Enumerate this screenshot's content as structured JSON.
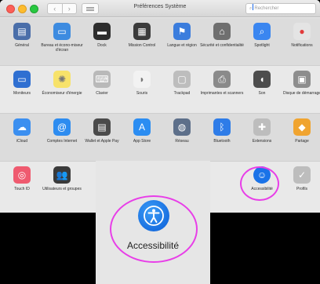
{
  "window": {
    "title": "Préférences Système"
  },
  "toolbar": {
    "back": "‹",
    "forward": "›",
    "search_placeholder": "Rechercher"
  },
  "rows": [
    {
      "items": [
        {
          "name": "general",
          "label": "Général",
          "icon": "general-icon",
          "color": "#4a6ea9",
          "glyph": "▤"
        },
        {
          "name": "desktop",
          "label": "Bureau et écono-miseur d'écran",
          "icon": "desktop-icon",
          "color": "#3d8be0",
          "glyph": "▭"
        },
        {
          "name": "dock",
          "label": "Dock",
          "icon": "dock-icon",
          "color": "#2d2d2d",
          "glyph": "▬"
        },
        {
          "name": "mission-control",
          "label": "Mission Control",
          "icon": "mission-control-icon",
          "color": "#3b3b3b",
          "glyph": "▦"
        },
        {
          "name": "language",
          "label": "Langue et région",
          "icon": "flag-icon",
          "color": "#3b7ddd",
          "glyph": "⚑"
        },
        {
          "name": "security",
          "label": "Sécurité et confidentialité",
          "icon": "house-lock-icon",
          "color": "#6f6f6f",
          "glyph": "⌂"
        },
        {
          "name": "spotlight",
          "label": "Spotlight",
          "icon": "spotlight-icon",
          "color": "#3a86f0",
          "glyph": "⌕"
        },
        {
          "name": "notifications",
          "label": "Notifications",
          "icon": "notifications-icon",
          "color": "#e4e4e4",
          "glyph": "●"
        }
      ]
    },
    {
      "items": [
        {
          "name": "displays",
          "label": "Moniteurs",
          "icon": "display-icon",
          "color": "#2f6fd1",
          "glyph": "▭"
        },
        {
          "name": "energy",
          "label": "Économiseur d'énergie",
          "icon": "bulb-icon",
          "color": "#f7e26a",
          "glyph": "✺"
        },
        {
          "name": "keyboard",
          "label": "Clavier",
          "icon": "keyboard-icon",
          "color": "#b9b9b9",
          "glyph": "⌨"
        },
        {
          "name": "mouse",
          "label": "Souris",
          "icon": "mouse-icon",
          "color": "#f2f2f2",
          "glyph": "◗"
        },
        {
          "name": "trackpad",
          "label": "Trackpad",
          "icon": "trackpad-icon",
          "color": "#bdbdbd",
          "glyph": "▢"
        },
        {
          "name": "printers",
          "label": "Imprimantes et scanners",
          "icon": "printer-icon",
          "color": "#8a8a8a",
          "glyph": "⎙"
        },
        {
          "name": "sound",
          "label": "Son",
          "icon": "speaker-icon",
          "color": "#4d4d4d",
          "glyph": "◖"
        },
        {
          "name": "startup",
          "label": "Disque de démarrage",
          "icon": "disk-icon",
          "color": "#8d8d8d",
          "glyph": "▣"
        }
      ]
    },
    {
      "items": [
        {
          "name": "icloud",
          "label": "iCloud",
          "icon": "cloud-icon",
          "color": "#3b8ff0",
          "glyph": "☁"
        },
        {
          "name": "internet-accounts",
          "label": "Comptes Internet",
          "icon": "at-icon",
          "color": "#2d8cf0",
          "glyph": "@"
        },
        {
          "name": "wallet",
          "label": "Wallet et Apple Pay",
          "icon": "wallet-icon",
          "color": "#4a4a4a",
          "glyph": "▤"
        },
        {
          "name": "app-store",
          "label": "App Store",
          "icon": "app-store-icon",
          "color": "#2b8df2",
          "glyph": "A"
        },
        {
          "name": "network",
          "label": "Réseau",
          "icon": "globe-icon",
          "color": "#5d6f8a",
          "glyph": "◍"
        },
        {
          "name": "bluetooth",
          "label": "Bluetooth",
          "icon": "bluetooth-icon",
          "color": "#2e7ce8",
          "glyph": "ᛒ"
        },
        {
          "name": "extensions",
          "label": "Extensions",
          "icon": "puzzle-icon",
          "color": "#bdbdbd",
          "glyph": "✚"
        },
        {
          "name": "sharing",
          "label": "Partage",
          "icon": "sharing-icon",
          "color": "#f0a430",
          "glyph": "◆"
        }
      ]
    },
    {
      "items": [
        {
          "name": "touch-id",
          "label": "Touch ID",
          "icon": "fingerprint-icon",
          "color": "#ef5a6f",
          "glyph": "◎"
        },
        {
          "name": "users",
          "label": "Utilisateurs et groupes",
          "icon": "users-icon",
          "color": "#3a3a3a",
          "glyph": "👥"
        },
        {
          "name": "accessibility",
          "label": "Accessibilité",
          "icon": "accessibility-icon",
          "color": "#1a73e8",
          "glyph": "☺"
        },
        {
          "name": "profiles",
          "label": "Profils",
          "icon": "checkmark-icon",
          "color": "#bdbdbd",
          "glyph": "✓"
        }
      ]
    }
  ],
  "zoom": {
    "label": "Accessibilité"
  },
  "colors": {
    "highlight": "#e83ee8",
    "accent": "#1a73e8"
  }
}
